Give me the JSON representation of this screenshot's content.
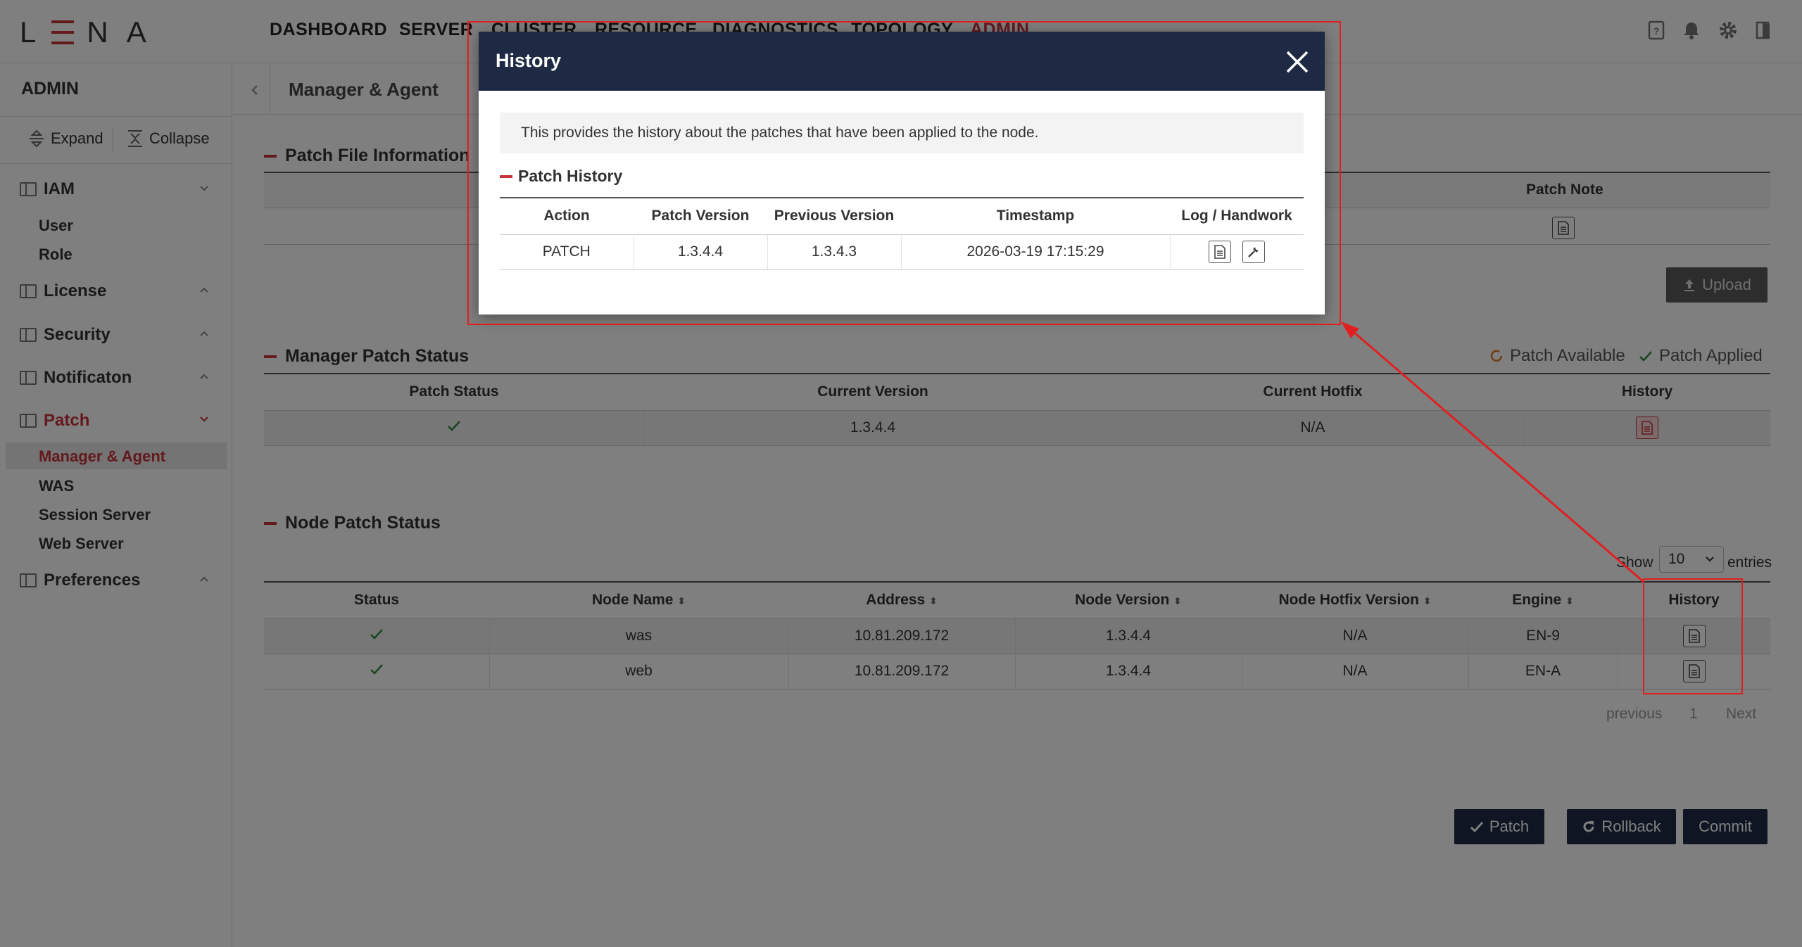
{
  "topbar": {
    "logo": "LENA",
    "nav": [
      "DASHBOARD",
      "SERVER",
      "CLUSTER",
      "RESOURCE",
      "DIAGNOSTICS",
      "TOPOLOGY",
      "ADMIN"
    ]
  },
  "sidebar": {
    "title": "ADMIN",
    "expand_label": "Expand",
    "collapse_label": "Collapse",
    "groups": [
      {
        "label": "IAM",
        "items": [
          "User",
          "Role"
        ]
      },
      {
        "label": "License"
      },
      {
        "label": "Security"
      },
      {
        "label": "Notificaton"
      },
      {
        "label": "Patch",
        "items": [
          "Manager & Agent",
          "WAS",
          "Session Server",
          "Web Server"
        ]
      },
      {
        "label": "Preferences"
      }
    ]
  },
  "main": {
    "title": "Manager & Agent",
    "patch_file": {
      "section_title": "Patch File Information",
      "patch_note_header": "Patch Note",
      "upload_label": "Upload"
    },
    "manager_status": {
      "section_title": "Manager Patch Status",
      "legend_available": "Patch Available",
      "legend_applied": "Patch Applied",
      "headers": [
        "Patch Status",
        "Current Version",
        "Current Hotfix",
        "History"
      ],
      "row": {
        "current_version": "1.3.4.4",
        "current_hotfix": "N/A"
      }
    },
    "node_status": {
      "section_title": "Node Patch Status",
      "show_label": "Show",
      "page_size": "10",
      "entries_label": "entries",
      "headers": [
        "Status",
        "Node Name",
        "Address",
        "Node Version",
        "Node Hotfix Version",
        "Engine",
        "History"
      ],
      "rows": [
        {
          "name": "was",
          "address": "10.81.209.172",
          "version": "1.3.4.4",
          "hotfix": "N/A",
          "engine": "EN-9"
        },
        {
          "name": "web",
          "address": "10.81.209.172",
          "version": "1.3.4.4",
          "hotfix": "N/A",
          "engine": "EN-A"
        }
      ],
      "pagination": {
        "previous": "previous",
        "page": "1",
        "next": "Next"
      }
    },
    "actions": {
      "patch": "Patch",
      "rollback": "Rollback",
      "commit": "Commit"
    }
  },
  "modal": {
    "title": "History",
    "info": "This provides the history about the patches that have been applied to the node.",
    "section_title": "Patch History",
    "headers": [
      "Action",
      "Patch Version",
      "Previous Version",
      "Timestamp",
      "Log / Handwork"
    ],
    "rows": [
      {
        "action": "PATCH",
        "patch_version": "1.3.4.4",
        "previous_version": "1.3.4.3",
        "timestamp": "2026-03-19 17:15:29"
      }
    ]
  },
  "colors": {
    "accent_red": "#c8323a",
    "navy": "#1e2a44",
    "check_green": "#2e8b3a",
    "annotation_red": "#e02020"
  }
}
